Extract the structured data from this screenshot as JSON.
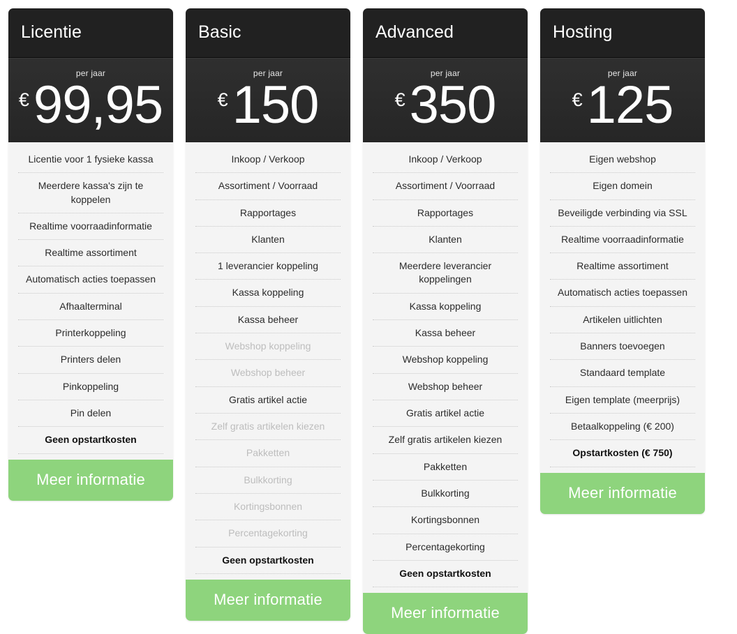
{
  "plans": [
    {
      "title": "Licentie",
      "period": "per jaar",
      "currency": "€",
      "amount": "99,95",
      "cta": "Meer informatie",
      "features": [
        {
          "label": "Licentie voor 1 fysieke kassa",
          "state": "active"
        },
        {
          "label": "Meerdere kassa's zijn te koppelen",
          "state": "active"
        },
        {
          "label": "Realtime voorraadinformatie",
          "state": "active"
        },
        {
          "label": "Realtime assortiment",
          "state": "active"
        },
        {
          "label": "Automatisch acties toepassen",
          "state": "active"
        },
        {
          "label": "Afhaalterminal",
          "state": "active"
        },
        {
          "label": "Printerkoppeling",
          "state": "active"
        },
        {
          "label": "Printers delen",
          "state": "active"
        },
        {
          "label": "Pinkoppeling",
          "state": "active"
        },
        {
          "label": "Pin delen",
          "state": "active"
        },
        {
          "label": "Geen opstartkosten",
          "state": "strong"
        }
      ]
    },
    {
      "title": "Basic",
      "period": "per jaar",
      "currency": "€",
      "amount": "150",
      "cta": "Meer informatie",
      "features": [
        {
          "label": "Inkoop / Verkoop",
          "state": "active"
        },
        {
          "label": "Assortiment / Voorraad",
          "state": "active"
        },
        {
          "label": "Rapportages",
          "state": "active"
        },
        {
          "label": "Klanten",
          "state": "active"
        },
        {
          "label": "1 leverancier koppeling",
          "state": "active"
        },
        {
          "label": "Kassa koppeling",
          "state": "active"
        },
        {
          "label": "Kassa beheer",
          "state": "active"
        },
        {
          "label": "Webshop koppeling",
          "state": "disabled"
        },
        {
          "label": "Webshop beheer",
          "state": "disabled"
        },
        {
          "label": "Gratis artikel actie",
          "state": "active"
        },
        {
          "label": "Zelf gratis artikelen kiezen",
          "state": "disabled"
        },
        {
          "label": "Pakketten",
          "state": "disabled"
        },
        {
          "label": "Bulkkorting",
          "state": "disabled"
        },
        {
          "label": "Kortingsbonnen",
          "state": "disabled"
        },
        {
          "label": "Percentagekorting",
          "state": "disabled"
        },
        {
          "label": "Geen opstartkosten",
          "state": "strong"
        }
      ]
    },
    {
      "title": "Advanced",
      "period": "per jaar",
      "currency": "€",
      "amount": "350",
      "cta": "Meer informatie",
      "features": [
        {
          "label": "Inkoop / Verkoop",
          "state": "active"
        },
        {
          "label": "Assortiment / Voorraad",
          "state": "active"
        },
        {
          "label": "Rapportages",
          "state": "active"
        },
        {
          "label": "Klanten",
          "state": "active"
        },
        {
          "label": "Meerdere leverancier koppelingen",
          "state": "active"
        },
        {
          "label": "Kassa koppeling",
          "state": "active"
        },
        {
          "label": "Kassa beheer",
          "state": "active"
        },
        {
          "label": "Webshop koppeling",
          "state": "active"
        },
        {
          "label": "Webshop beheer",
          "state": "active"
        },
        {
          "label": "Gratis artikel actie",
          "state": "active"
        },
        {
          "label": "Zelf gratis artikelen kiezen",
          "state": "active"
        },
        {
          "label": "Pakketten",
          "state": "active"
        },
        {
          "label": "Bulkkorting",
          "state": "active"
        },
        {
          "label": "Kortingsbonnen",
          "state": "active"
        },
        {
          "label": "Percentagekorting",
          "state": "active"
        },
        {
          "label": "Geen opstartkosten",
          "state": "strong"
        }
      ]
    },
    {
      "title": "Hosting",
      "period": "per jaar",
      "currency": "€",
      "amount": "125",
      "cta": "Meer informatie",
      "features": [
        {
          "label": "Eigen webshop",
          "state": "active"
        },
        {
          "label": "Eigen domein",
          "state": "active"
        },
        {
          "label": "Beveiligde verbinding via SSL",
          "state": "active"
        },
        {
          "label": "Realtime voorraadinformatie",
          "state": "active"
        },
        {
          "label": "Realtime assortiment",
          "state": "active"
        },
        {
          "label": "Automatisch acties toepassen",
          "state": "active"
        },
        {
          "label": "Artikelen uitlichten",
          "state": "active"
        },
        {
          "label": "Banners toevoegen",
          "state": "active"
        },
        {
          "label": "Standaard template",
          "state": "active"
        },
        {
          "label": "Eigen template (meerprijs)",
          "state": "active"
        },
        {
          "label": "Betaalkoppeling (€ 200)",
          "state": "active"
        },
        {
          "label": "Opstartkosten (€ 750)",
          "state": "strong"
        }
      ]
    }
  ],
  "colors": {
    "header_bg": "#212121",
    "price_bg": "#2d2d2d",
    "body_bg": "#f4f4f4",
    "cta_green": "#8ed47d",
    "text_dark": "#2b2b2b",
    "text_disabled": "#bdbdbd"
  }
}
